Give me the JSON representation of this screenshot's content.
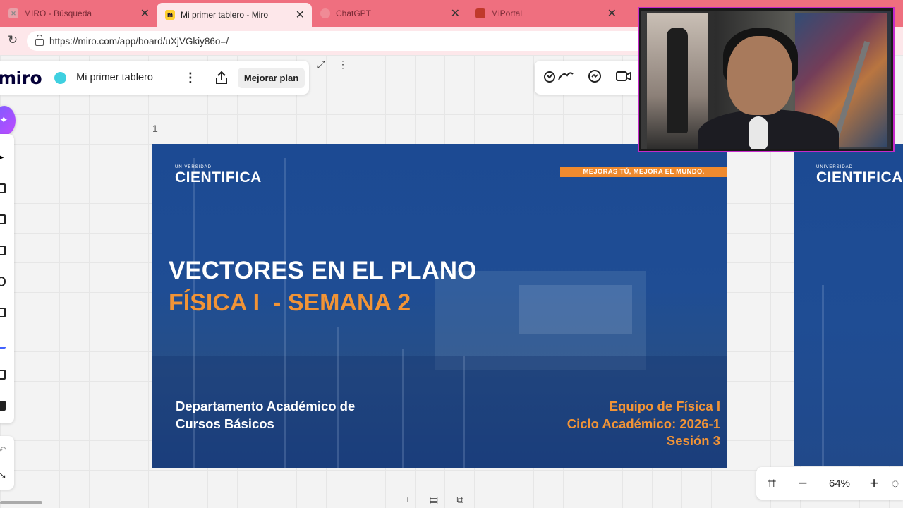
{
  "browser": {
    "tabs": [
      {
        "title": "MIRO - Búsqueda",
        "favicon_color": "#c0c0c0",
        "active": false
      },
      {
        "title": "Mi primer tablero - Miro",
        "favicon_color": "#ffd02f",
        "active": true
      },
      {
        "title": "ChatGPT",
        "favicon_color": "#f08b96",
        "active": false
      },
      {
        "title": "MiPortal",
        "favicon_color": "#c0392b",
        "active": false
      }
    ],
    "url": "https://miro.com/app/board/uXjVGkiy86o=/"
  },
  "miro": {
    "logo": "miro",
    "board_name": "Mi primer tablero",
    "upgrade_label": "Mejorar plan",
    "frame_number": "1",
    "zoom": "64%"
  },
  "slide": {
    "logo_small": "UNIVERSIDAD",
    "logo_name": "CIENTIFICA",
    "banner": "MEJORAS TÚ, MEJORA EL MUNDO.",
    "title": "VECTORES EN EL PLANO",
    "subtitle": "FÍSICA I  - SEMANA 2",
    "department_line1": "Departamento Académico de",
    "department_line2": "Cursos Básicos",
    "team_line1": "Equipo de Física I",
    "team_line2": "Ciclo Académico: 2026-1",
    "team_line3": "Sesión 3"
  },
  "colors": {
    "tab_strip": "#ef6f7f",
    "slide_blue": "#1f4d94",
    "accent_orange": "#f29436",
    "miro_ai": "#7b5cff",
    "webcam_border": "#c52ac9"
  }
}
